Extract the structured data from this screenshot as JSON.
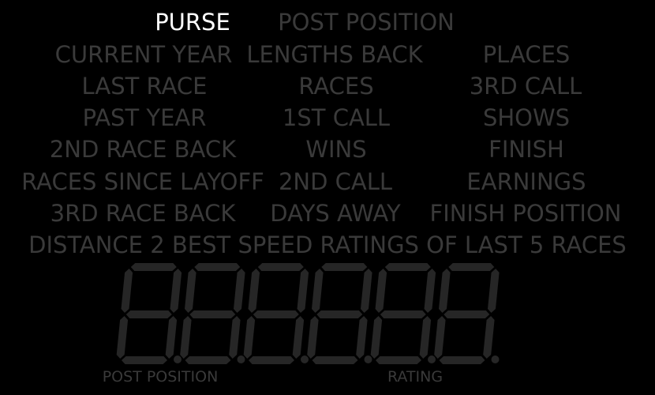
{
  "theme": {
    "background": "#000000",
    "active_color": "#ffffff",
    "inactive_color": "#3a3a3a",
    "segment_off_color": "#262626"
  },
  "display_state": {
    "digit_count": 6,
    "all_segments": "off"
  },
  "selected_label": "PURSE",
  "labels": {
    "purse": "PURSE",
    "post_position": "POST POSITION",
    "current_year": "CURRENT YEAR",
    "lengths_back": "LENGTHS BACK",
    "places": "PLACES",
    "last_race": "LAST RACE",
    "races": "RACES",
    "third_call": "3RD CALL",
    "past_year": "PAST YEAR",
    "first_call": "1ST CALL",
    "shows": "SHOWS",
    "second_race_back": "2ND RACE BACK",
    "wins": "WINS",
    "finish": "FINISH",
    "races_since_layoff": "RACES SINCE LAYOFF",
    "second_call": "2ND CALL",
    "earnings": "EARNINGS",
    "third_race_back": "3RD RACE BACK",
    "days_away": "DAYS AWAY",
    "finish_position": "FINISH POSITION",
    "distance_speed": "DISTANCE 2 BEST SPEED RATINGS OF LAST 5 RACES"
  },
  "display_labels": {
    "left": "POST POSITION",
    "right": "RATING"
  }
}
